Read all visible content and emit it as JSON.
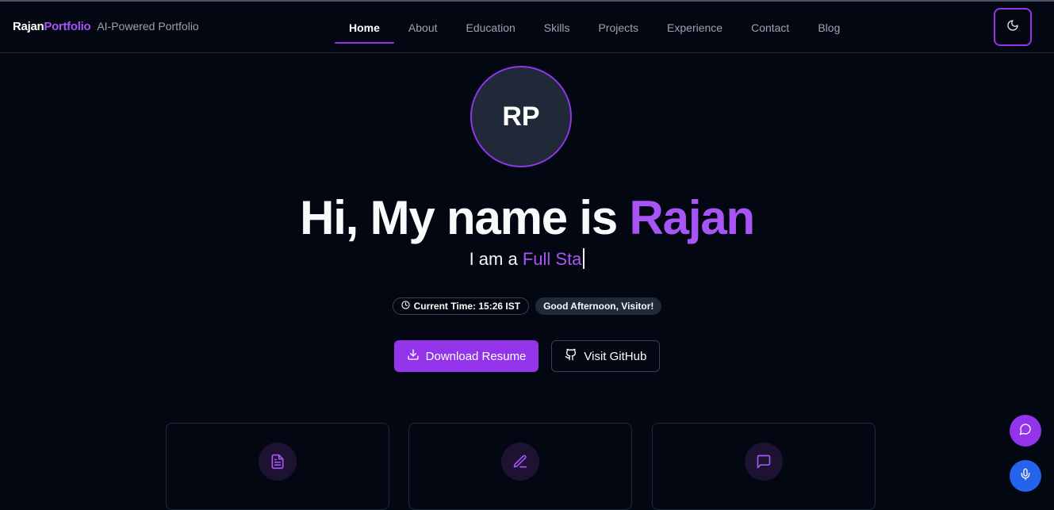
{
  "brand": {
    "name_part1": "Rajan",
    "name_part2": "Portfolio",
    "tagline": "AI-Powered Portfolio"
  },
  "nav": {
    "items": [
      {
        "label": "Home",
        "active": true
      },
      {
        "label": "About",
        "active": false
      },
      {
        "label": "Education",
        "active": false
      },
      {
        "label": "Skills",
        "active": false
      },
      {
        "label": "Projects",
        "active": false
      },
      {
        "label": "Experience",
        "active": false
      },
      {
        "label": "Contact",
        "active": false
      },
      {
        "label": "Blog",
        "active": false
      }
    ],
    "theme_toggle_icon": "moon-icon"
  },
  "hero": {
    "avatar_initials": "RP",
    "headline_prefix": "Hi, My name is ",
    "headline_name": "Rajan",
    "subline_prefix": "I am a ",
    "subline_role": "Full Sta",
    "time_badge": "Current Time: 15:26 IST",
    "greeting_badge": "Good Afternoon, Visitor!",
    "download_button": "Download Resume",
    "github_button": "Visit GitHub"
  },
  "cards": [
    {
      "icon": "document-icon"
    },
    {
      "icon": "pen-icon"
    },
    {
      "icon": "message-square-icon"
    }
  ],
  "floating": {
    "chat_icon": "chat-bubble-icon",
    "mic_icon": "microphone-icon"
  },
  "colors": {
    "background": "#030712",
    "accent": "#9333ea",
    "accent_text": "#a855f7",
    "mic_button": "#2563eb"
  }
}
